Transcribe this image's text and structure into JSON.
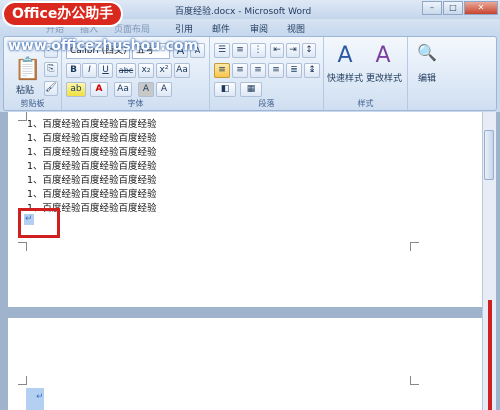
{
  "window": {
    "title": "百度经验.docx - Microsoft Word",
    "minimize": "–",
    "maximize": "□",
    "close": "✕"
  },
  "logo": "Office办公助手",
  "watermark": "www.officezhushou.com",
  "tabs": [
    {
      "label": "开始"
    },
    {
      "label": "插入"
    },
    {
      "label": "页面布局"
    },
    {
      "label": "引用"
    },
    {
      "label": "邮件"
    },
    {
      "label": "审阅"
    },
    {
      "label": "视图"
    }
  ],
  "ribbon": {
    "clipboard": {
      "paste_label": "粘贴",
      "group_label": "剪贴板"
    },
    "font": {
      "font_name": "Calibri (西文)",
      "font_size": "五号",
      "grow": "A",
      "shrink": "A",
      "clear_format": "Aa",
      "bold": "B",
      "italic": "I",
      "underline": "U",
      "strike": "abc",
      "subscript": "x₂",
      "superscript": "x²",
      "highlight": "ab",
      "font_color": "A",
      "change_case": "Aa",
      "char_shading": "A",
      "char_border": "A",
      "group_label": "字体"
    },
    "paragraph": {
      "group_label": "段落"
    },
    "styles": {
      "quick_styles": "快速样式",
      "change_styles": "更改样式",
      "group_label": "样式"
    },
    "editing": {
      "label": "编辑"
    }
  },
  "document": {
    "lines": [
      "1、百度经验百度经验百度经验",
      "1、百度经验百度经验百度经验",
      "1、百度经验百度经验百度经验",
      "1、百度经验百度经验百度经验",
      "1、百度经验百度经验百度经验",
      "1、百度经验百度经验百度经验",
      "1、百度经验百度经验百度经验"
    ],
    "para_mark": "↵"
  }
}
